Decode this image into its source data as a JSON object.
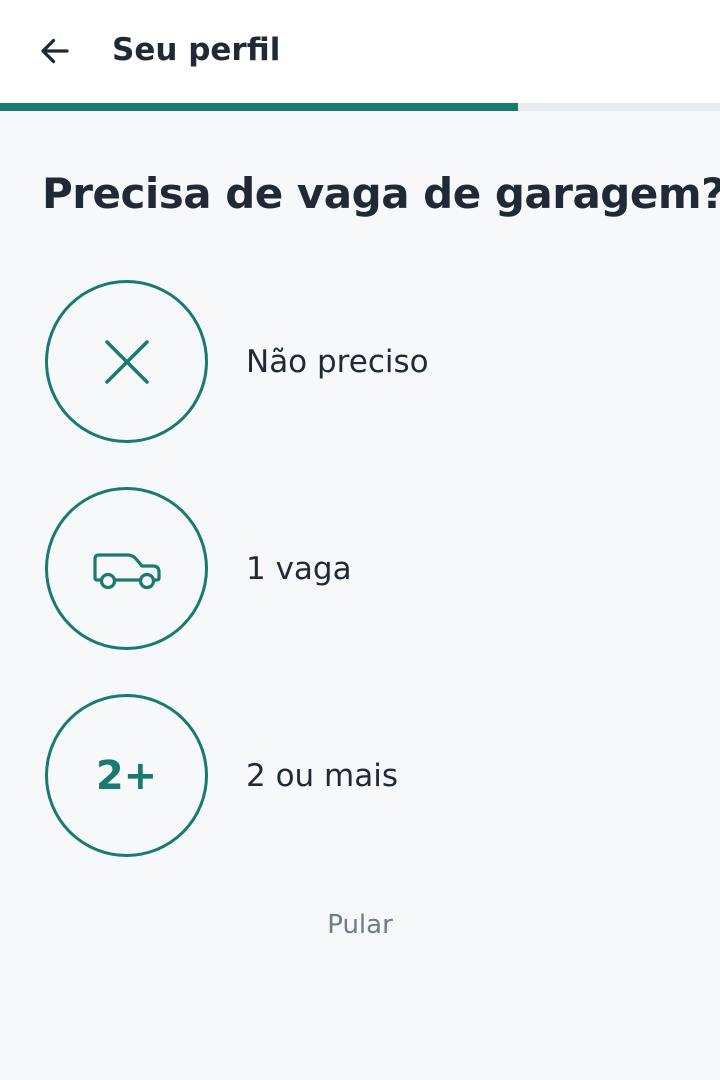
{
  "header": {
    "back_icon": "arrow-left-icon",
    "title": "Seu perfil"
  },
  "progress": {
    "fraction": 0.72,
    "fill_color": "#1a7a6f",
    "track_color": "#e8ebee"
  },
  "question": "Precisa de vaga de garagem?",
  "options": [
    {
      "icon": "close-icon",
      "label": "Não preciso"
    },
    {
      "icon": "car-icon",
      "label": "1 vaga"
    },
    {
      "icon_text": "2+",
      "label": "2 ou mais"
    }
  ],
  "skip_label": "Pular",
  "colors": {
    "accent": "#1a7a6f",
    "text": "#1f2a36",
    "muted": "#6e7b88",
    "background": "#f6f8fa"
  }
}
